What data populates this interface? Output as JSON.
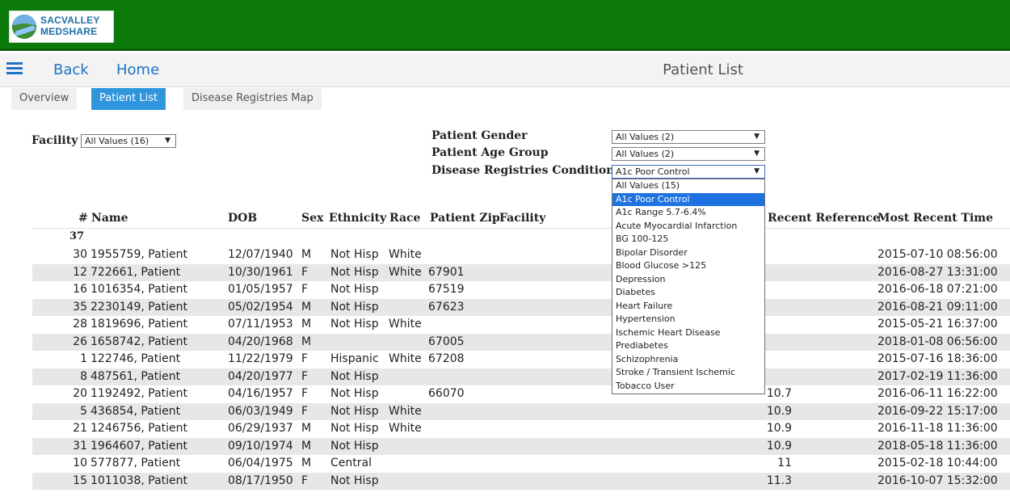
{
  "brand": {
    "line1": "SACVALLEY",
    "line2": "MEDSHARE"
  },
  "nav": {
    "back": "Back",
    "home": "Home",
    "title": "Patient List"
  },
  "tabs": [
    "Overview",
    "Patient List",
    "Disease Registries Map"
  ],
  "filters": {
    "facility": {
      "label": "Facility",
      "value": "All Values (16)"
    },
    "gender": {
      "label": "Patient Gender",
      "value": "All Values (2)"
    },
    "age_group": {
      "label": "Patient Age Group",
      "value": "All Values (2)"
    },
    "condition": {
      "label": "Disease Registries Condition",
      "value": "A1c Poor Control"
    }
  },
  "condition_options": [
    "All Values (15)",
    "A1c Poor Control",
    "A1c Range 5.7-6.4%",
    "Acute Myocardial Infarction",
    "BG 100-125",
    "Bipolar Disorder",
    "Blood Glucose >125",
    "Depression",
    "Diabetes",
    "Heart Failure",
    "Hypertension",
    "Ischemic Heart Disease",
    "Prediabetes",
    "Schizophrenia",
    "Stroke / Transient Ischemic",
    "Tobacco User"
  ],
  "table": {
    "headers": {
      "num": "#",
      "name": "Name",
      "dob": "DOB",
      "sex": "Sex",
      "ethnicity": "Ethnicity",
      "race": "Race",
      "zip": "Patient Zip",
      "facility": "Facility",
      "ref": "Recent Reference",
      "time": "Most Recent Time"
    },
    "total": "37",
    "rows": [
      {
        "num": "30",
        "name": "1955759, Patient",
        "dob": "12/07/1940",
        "sex": "M",
        "ethnicity": "Not Hisp",
        "race": "White",
        "zip": "",
        "ref": "",
        "time": "2015-07-10 08:56:00"
      },
      {
        "num": "12",
        "name": "722661, Patient",
        "dob": "10/30/1961",
        "sex": "F",
        "ethnicity": "Not Hisp",
        "race": "White",
        "zip": "67901",
        "ref": "",
        "time": "2016-08-27 13:31:00"
      },
      {
        "num": "16",
        "name": "1016354, Patient",
        "dob": "01/05/1957",
        "sex": "F",
        "ethnicity": "Not Hisp",
        "race": "",
        "zip": "67519",
        "ref": "",
        "time": "2016-06-18 07:21:00"
      },
      {
        "num": "35",
        "name": "2230149, Patient",
        "dob": "05/02/1954",
        "sex": "M",
        "ethnicity": "Not Hisp",
        "race": "",
        "zip": "67623",
        "ref": "",
        "time": "2016-08-21 09:11:00"
      },
      {
        "num": "28",
        "name": "1819696, Patient",
        "dob": "07/11/1953",
        "sex": "M",
        "ethnicity": "Not Hisp",
        "race": "White",
        "zip": "",
        "ref": "",
        "time": "2015-05-21 16:37:00"
      },
      {
        "num": "26",
        "name": "1658742, Patient",
        "dob": "04/20/1968",
        "sex": "M",
        "ethnicity": "",
        "race": "",
        "zip": "67005",
        "ref": "",
        "time": "2018-01-08 06:56:00"
      },
      {
        "num": "1",
        "name": "122746, Patient",
        "dob": "11/22/1979",
        "sex": "F",
        "ethnicity": "Hispanic",
        "race": "White",
        "zip": "67208",
        "ref": "",
        "time": "2015-07-16 18:36:00"
      },
      {
        "num": "8",
        "name": "487561, Patient",
        "dob": "04/20/1977",
        "sex": "F",
        "ethnicity": "Not Hisp",
        "race": "",
        "zip": "",
        "ref": "",
        "time": "2017-02-19 11:36:00"
      },
      {
        "num": "20",
        "name": "1192492, Patient",
        "dob": "04/16/1957",
        "sex": "F",
        "ethnicity": "Not Hisp",
        "race": "",
        "zip": "66070",
        "ref": "10.7",
        "time": "2016-06-11 16:22:00"
      },
      {
        "num": "5",
        "name": "436854, Patient",
        "dob": "06/03/1949",
        "sex": "F",
        "ethnicity": "Not Hisp",
        "race": "White",
        "zip": "",
        "ref": "10.9",
        "time": "2016-09-22 15:17:00"
      },
      {
        "num": "21",
        "name": "1246756, Patient",
        "dob": "06/29/1937",
        "sex": "M",
        "ethnicity": "Not Hisp",
        "race": "White",
        "zip": "",
        "ref": "10.9",
        "time": "2016-11-18 11:36:00"
      },
      {
        "num": "31",
        "name": "1964607, Patient",
        "dob": "09/10/1974",
        "sex": "M",
        "ethnicity": "Not Hisp",
        "race": "",
        "zip": "",
        "ref": "10.9",
        "time": "2018-05-18 11:36:00"
      },
      {
        "num": "10",
        "name": "577877, Patient",
        "dob": "06/04/1975",
        "sex": "M",
        "ethnicity": "Central",
        "race": "",
        "zip": "",
        "ref": "11",
        "time": "2015-02-18 10:44:00"
      },
      {
        "num": "15",
        "name": "1011038, Patient",
        "dob": "08/17/1950",
        "sex": "F",
        "ethnicity": "Not Hisp",
        "race": "",
        "zip": "",
        "ref": "11.3",
        "time": "2016-10-07 15:32:00"
      }
    ]
  }
}
